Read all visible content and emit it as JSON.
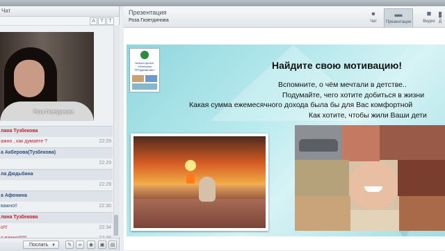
{
  "chat": {
    "header_title": "Чат",
    "video_name": "Роза Гизетдинова",
    "messages": [
      {
        "type": "head",
        "text": "лана Тузбекова",
        "color": "red",
        "time": ""
      },
      {
        "type": "msg",
        "text": "ажно , как думаете ?",
        "color": "red",
        "time": "22:29"
      },
      {
        "type": "head",
        "text": "а Акберова(Тузбекова)",
        "color": "blue",
        "time": ""
      },
      {
        "type": "msg",
        "text": "",
        "color": "blue",
        "time": "22:29"
      },
      {
        "type": "head",
        "text": "ла Дюдьбина",
        "color": "blue",
        "time": ""
      },
      {
        "type": "msg",
        "text": "",
        "color": "blue",
        "time": "22:29"
      },
      {
        "type": "head",
        "text": "а Афонина",
        "color": "blue",
        "time": ""
      },
      {
        "type": "msg",
        "text": "важно!!",
        "color": "blue",
        "time": "22:30"
      },
      {
        "type": "head",
        "text": "лана Тузбекова",
        "color": "red",
        "time": ""
      },
      {
        "type": "msg",
        "text": "о!!!",
        "color": "red",
        "time": "22:34"
      },
      {
        "type": "msg",
        "text": "о важно!!!!!!",
        "color": "red",
        "time": "22:38"
      }
    ],
    "send_label": "Послать"
  },
  "presentation": {
    "title": "Презентация",
    "presenter": "Роза Гизетдинова",
    "tabs": [
      {
        "label": "Чат",
        "icon": "chat-bubble-icon",
        "active": false
      },
      {
        "label": "Презентация",
        "icon": "presentation-board-icon",
        "active": true
      },
      {
        "label": "Видео",
        "icon": "video-camera-icon",
        "active": false
      },
      {
        "label": "Д",
        "icon": "document-icon",
        "active": false
      }
    ],
    "slide": {
      "logo_text": "Бизнес-проект «Успешное ПРОдвижение»",
      "heading": "Найдите свою мотивацию!",
      "lines": [
        "Вспомните, о чём мечтали в детстве..",
        "Подумайте, чего хотите добиться в жизни",
        "Какая сумма ежемесячного дохода была бы для Вас комфортной",
        "Как хотите, чтобы жили Ваши дети"
      ]
    }
  }
}
